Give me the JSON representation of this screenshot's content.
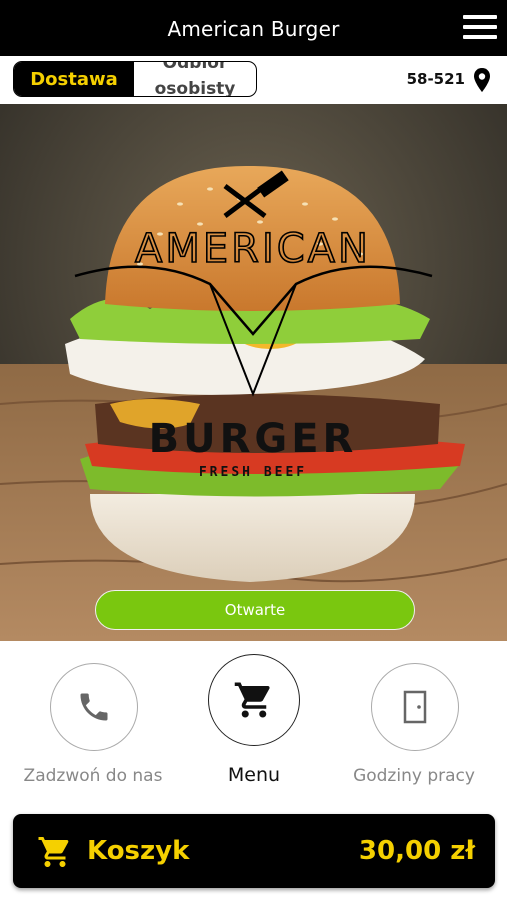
{
  "header": {
    "title": "American Burger",
    "menu_icon": "hamburger-menu-icon"
  },
  "order_mode": {
    "delivery_label": "Dostawa",
    "pickup_label": "Odbiór osobisty",
    "active": "delivery"
  },
  "location": {
    "postcode": "58-521",
    "icon": "location-pin-icon"
  },
  "hero": {
    "logo_top": "AMERICAN",
    "logo_bottom": "BURGER",
    "logo_tagline": "FRESH BEEF",
    "status_label": "Otwarte"
  },
  "actions": [
    {
      "label": "Zadzwoń do nas",
      "icon": "phone-icon"
    },
    {
      "label": "Menu",
      "icon": "cart-icon"
    },
    {
      "label": "Godziny pracy",
      "icon": "door-icon"
    }
  ],
  "cart": {
    "label": "Koszyk",
    "total": "30,00 zł",
    "icon": "cart-icon"
  },
  "colors": {
    "accent_yellow": "#f5d000",
    "status_green": "#7ac70f",
    "bar_black": "#000000"
  }
}
